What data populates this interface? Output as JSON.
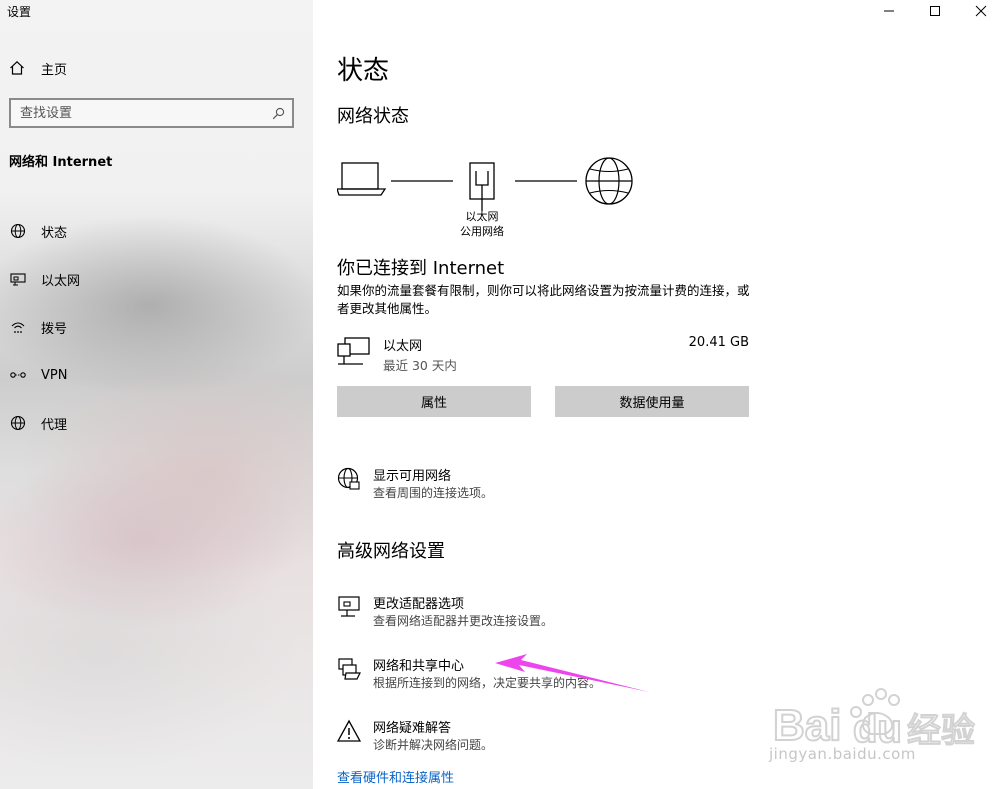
{
  "window": {
    "title": "设置"
  },
  "sidebar": {
    "home_label": "主页",
    "search_placeholder": "查找设置",
    "section_title": "网络和 Internet",
    "items": [
      {
        "label": "状态",
        "icon": "globe-icon"
      },
      {
        "label": "以太网",
        "icon": "ethernet-icon"
      },
      {
        "label": "拨号",
        "icon": "dialup-icon"
      },
      {
        "label": "VPN",
        "icon": "vpn-icon"
      },
      {
        "label": "代理",
        "icon": "globe-icon"
      }
    ]
  },
  "main": {
    "page_title": "状态",
    "network_status_heading": "网络状态",
    "diagram": {
      "device_label": "以太网",
      "network_type": "公用网络"
    },
    "connected_title": "你已连接到 Internet",
    "connected_desc": "如果你的流量套餐有限制，则你可以将此网络设置为按流量计费的连接，或者更改其他属性。",
    "ethernet": {
      "name": "以太网",
      "period": "最近 30 天内",
      "usage": "20.41 GB"
    },
    "buttons": {
      "properties": "属性",
      "data_usage": "数据使用量"
    },
    "show_networks": {
      "title": "显示可用网络",
      "desc": "查看周围的连接选项。"
    },
    "advanced_heading": "高级网络设置",
    "advanced_items": [
      {
        "title": "更改适配器选项",
        "desc": "查看网络适配器并更改连接设置。"
      },
      {
        "title": "网络和共享中心",
        "desc": "根据所连接到的网络，决定要共享的内容。"
      },
      {
        "title": "网络疑难解答",
        "desc": "诊断并解决网络问题。"
      }
    ],
    "hardware_link": "查看硬件和连接属性"
  },
  "watermark": {
    "url": "jingyan.baidu.com"
  },
  "colors": {
    "link": "#0a64c8",
    "button": "#cccccc",
    "arrow": "#ee44ee"
  }
}
